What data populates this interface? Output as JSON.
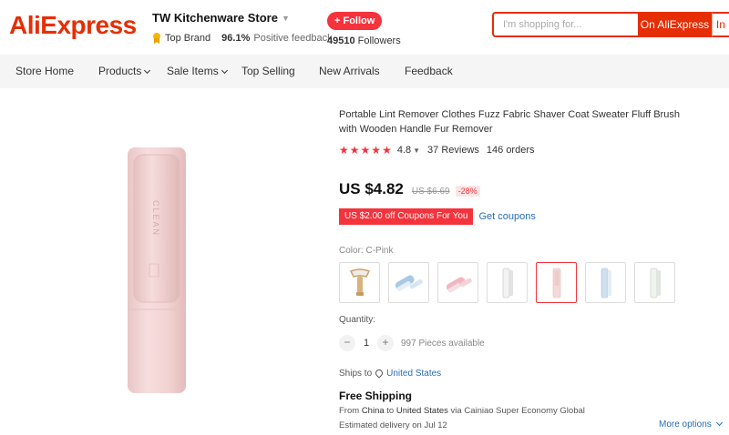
{
  "header": {
    "logo": "AliExpress",
    "store_name": "TW Kitchenware Store",
    "top_brand": "Top Brand",
    "positive_pct": "96.1%",
    "positive_label": "Positive feedback",
    "follow_label": "+ Follow",
    "followers_count": "49510",
    "followers_label": "Followers",
    "search_placeholder": "I'm shopping for...",
    "search_btn": "On AliExpress",
    "search_btn2": "In"
  },
  "nav": {
    "items": [
      "Store Home",
      "Products",
      "Sale Items",
      "Top Selling",
      "New Arrivals",
      "Feedback"
    ]
  },
  "product": {
    "title": "Portable Lint Remover Clothes Fuzz Fabric Shaver Coat Sweater Fluff Brush with Wooden Handle Fur Remover",
    "rating": "4.8",
    "stars": 5,
    "reviews": "37 Reviews",
    "orders": "146 orders",
    "price": "US $4.82",
    "old_price": "US $6.69",
    "discount": "-28%",
    "coupon": "US $2.00 off Coupons For You",
    "get_coupons": "Get coupons",
    "color_label": "Color:",
    "color_value": "C-Pink",
    "swatches": [
      "wooden-handle-brush",
      "blue-brush",
      "pink-brush",
      "white-roller",
      "pink-roller",
      "blue-roller",
      "white-green-roller"
    ],
    "selected_swatch": 4,
    "image_text": "CLEAN",
    "quantity_label": "Quantity:",
    "quantity_minus": "−",
    "quantity_plus": "+",
    "quantity": "1",
    "pieces_available": "997 Pieces available",
    "ships_to_label": "Ships to",
    "ships_to_country": "United States",
    "free_shipping": "Free Shipping",
    "ship_from_prefix": "From",
    "ship_from": "China",
    "ship_to_word": "to",
    "ship_to": "United States",
    "ship_via": "via Cainiao Super Economy Global",
    "delivery": "Estimated delivery on Jul 12",
    "more_options": "More options"
  },
  "colors": {
    "brand": "#e62e04",
    "accent": "#f4333c",
    "link": "#2a6db8",
    "product_pink": "#f3d6d6"
  }
}
